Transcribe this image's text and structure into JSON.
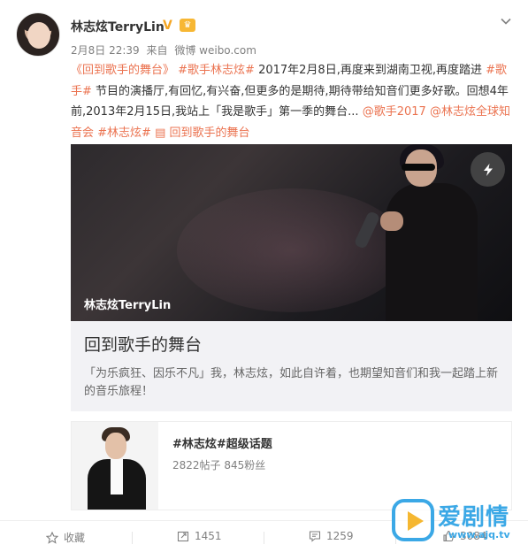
{
  "post": {
    "author": "林志炫TerryLin",
    "time": "2月8日 22:39",
    "via_label": "来自",
    "source": "微博 weibo.com",
    "text_parts": [
      {
        "t": "《回到歌手的舞台》",
        "style": "link"
      },
      {
        "t": " #歌手林志炫# ",
        "style": "link"
      },
      {
        "t": "2017年2月8日,再度来到湖南卫视,再度踏进 ",
        "style": "plain"
      },
      {
        "t": "#歌手#",
        "style": "link"
      },
      {
        "t": " 节目的演播厅,有回忆,有兴奋,但更多的是期待,期待带给知音们更多好歌。回想4年前,2013年2月15日,我站上「我是歌手」第一季的舞台... ",
        "style": "plain"
      },
      {
        "t": "@歌手2017",
        "style": "link"
      },
      {
        "t": " ",
        "style": "plain"
      },
      {
        "t": "@林志炫全球知音会",
        "style": "link"
      },
      {
        "t": " ",
        "style": "plain"
      },
      {
        "t": "#林志炫#",
        "style": "link"
      },
      {
        "t": "   ",
        "style": "plain"
      },
      {
        "t": "▤ 回到歌手的舞台",
        "style": "link"
      }
    ]
  },
  "card": {
    "image_caption": "林志炫TerryLin",
    "title": "回到歌手的舞台",
    "description": "「为乐疯狂、因乐不凡」我，林志炫，如此自许着，也期望知音们和我一起踏上新的音乐旅程！"
  },
  "topic": {
    "title": "#林志炫#超级话题",
    "stats": "2822帖子 845粉丝"
  },
  "footer": {
    "favorite_label": "收藏",
    "repost_count": "1451",
    "comment_count": "1259",
    "like_count": "3084"
  },
  "watermark": {
    "text": "爱剧情",
    "url": "www.ajq.tv"
  },
  "colors": {
    "link": "#eb7350",
    "watermark": "#3ba8e6"
  },
  "icons": [
    "verified-icon",
    "vip-icon",
    "chevron-down-icon",
    "flash-icon",
    "star-icon",
    "repost-icon",
    "comment-icon",
    "like-icon"
  ]
}
